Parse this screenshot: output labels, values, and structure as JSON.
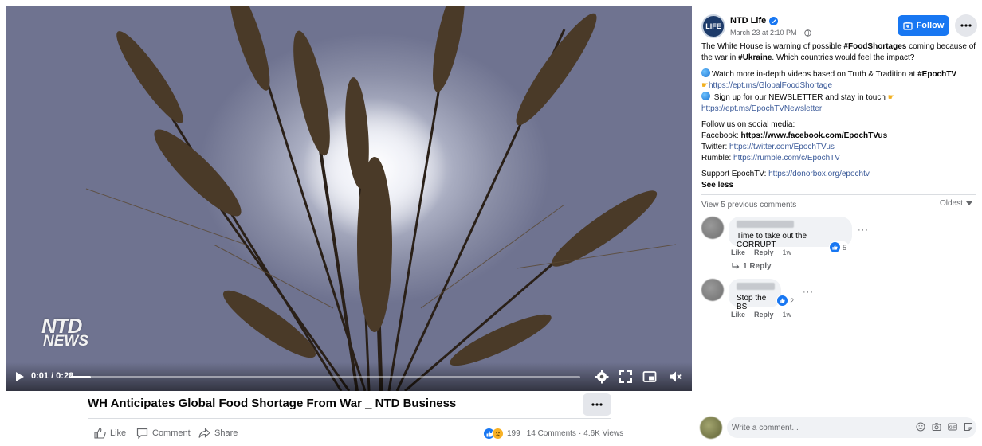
{
  "video": {
    "logo_line1": "NTD",
    "logo_line2": "NEWS",
    "time_display": "0:01 / 0:28",
    "progress_fraction": 0.04,
    "title": "WH Anticipates Global Food Shortage From War _ NTD Business"
  },
  "actions": {
    "like": "Like",
    "comment": "Comment",
    "share": "Share"
  },
  "stats": {
    "reaction_count": "199",
    "comments": "14 Comments",
    "views": "4.6K Views"
  },
  "post": {
    "avatar_text": "LIFE",
    "page_name": "NTD Life",
    "date": "March 23 at 2:10 PM",
    "follow_label": "Follow",
    "caption": {
      "p1_a": "The White House is warning of possible ",
      "p1_tag1": "#FoodShortages",
      "p1_b": " coming because of the war in ",
      "p1_tag2": "#Ukraine",
      "p1_c": ". Which countries would feel the impact?",
      "p2_a": "Watch more in-depth videos based on Truth & Tradition at ",
      "p2_tag": "#EpochTV",
      "p2_link": "https://ept.ms/GlobalFoodShortage",
      "p2_b": " Sign up for our NEWSLETTER and stay in touch ",
      "p2_link2": "https://ept.ms/EpochTVNewsletter",
      "p3_title": "Follow us on social media:",
      "p3_fb_label": "Facebook: ",
      "p3_fb_link": "https://www.facebook.com/EpochTVus",
      "p3_tw_label": "Twitter: ",
      "p3_tw_link": "https://twitter.com/EpochTVus",
      "p3_rm_label": "Rumble: ",
      "p3_rm_link": "https://rumble.com/c/EpochTV",
      "p4_label": "Support EpochTV: ",
      "p4_link": "https://donorbox.org/epochtv",
      "see_less": "See less"
    }
  },
  "comments_section": {
    "view_previous": "View 5 previous comments",
    "sort": "Oldest",
    "items": [
      {
        "text": "Time to take out the CORRUPT",
        "reactions": "5",
        "like": "Like",
        "reply": "Reply",
        "age": "1w",
        "replies_link": "1 Reply"
      },
      {
        "text": "Stop the BS",
        "reactions": "2",
        "like": "Like",
        "reply": "Reply",
        "age": "1w"
      }
    ],
    "write_placeholder": "Write a comment..."
  },
  "colors": {
    "accent": "#1877f2",
    "link": "#385898",
    "muted": "#65676b",
    "bubble": "#f0f2f5"
  }
}
